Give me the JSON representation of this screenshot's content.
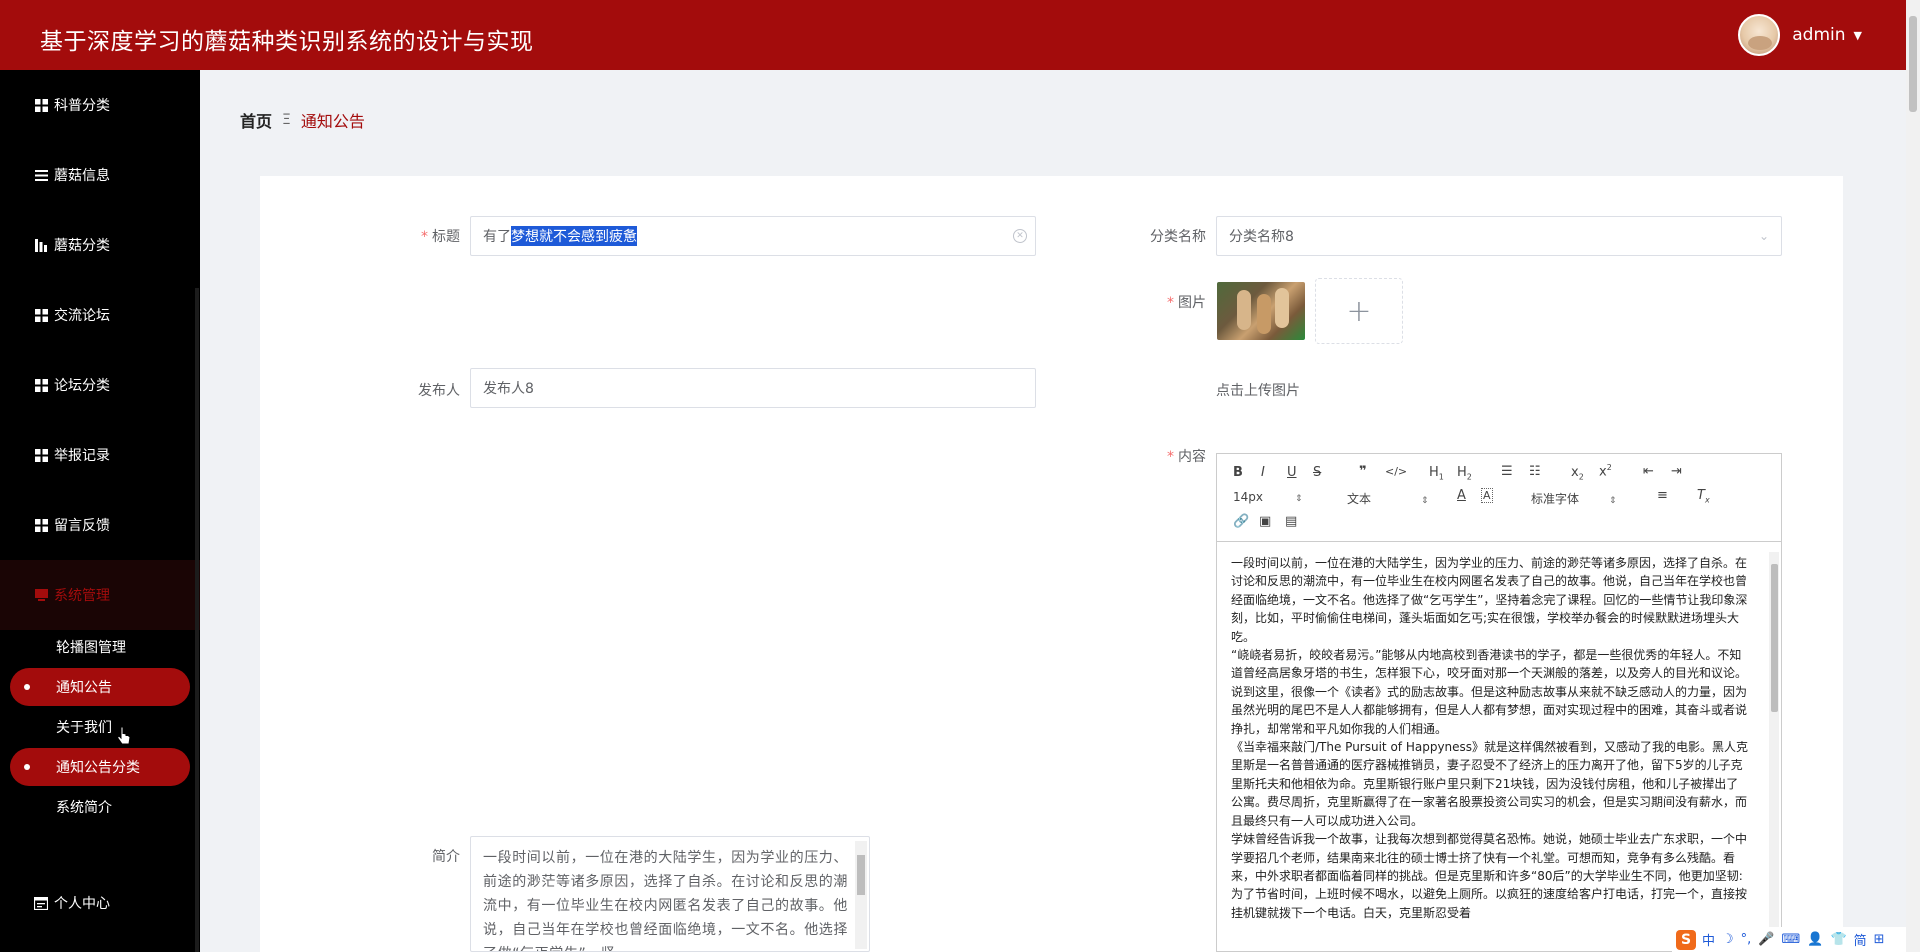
{
  "header": {
    "title": "基于深度学习的蘑菇种类识别系统的设计与实现",
    "username": "admin",
    "caret": "▼"
  },
  "sidebar": {
    "items": [
      {
        "label": "科普分类",
        "icon": "grid-icon"
      },
      {
        "label": "蘑菇信息",
        "icon": "list-icon"
      },
      {
        "label": "蘑菇分类",
        "icon": "chart-icon"
      },
      {
        "label": "交流论坛",
        "icon": "grid-icon"
      },
      {
        "label": "论坛分类",
        "icon": "grid-icon"
      },
      {
        "label": "举报记录",
        "icon": "grid-icon"
      },
      {
        "label": "留言反馈",
        "icon": "grid-icon"
      },
      {
        "label": "系统管理",
        "icon": "card-icon",
        "active": true
      }
    ],
    "sub_items": [
      {
        "label": "轮播图管理",
        "selected": false
      },
      {
        "label": "通知公告",
        "selected": true
      },
      {
        "label": "关于我们",
        "selected": false
      },
      {
        "label": "通知公告分类",
        "selected": true
      },
      {
        "label": "系统简介",
        "selected": false
      }
    ],
    "personal": {
      "label": "个人中心",
      "icon": "profile-icon"
    }
  },
  "breadcrumb": {
    "home": "首页",
    "separator": "Ξ",
    "current": "通知公告"
  },
  "form": {
    "title_label": "标题",
    "title_value_prefix": "有了",
    "title_value_selected": "梦想就不会感到疲惫",
    "category_label": "分类名称",
    "category_value": "分类名称8",
    "image_label": "图片",
    "upload_plus": "+",
    "upload_hint": "点击上传图片",
    "publisher_label": "发布人",
    "publisher_placeholder": "发布人8",
    "content_label": "内容",
    "summary_label": "简介",
    "summary_text": "一段时间以前，一位在港的大陆学生，因为学业的压力、前途的渺茫等诸多原因，选择了自杀。在讨论和反思的潮流中，有一位毕业生在校内网匿名发表了自己的故事。他说，自己当年在学校也曾经面临绝境，一文不名。他选择了做“乞丐学生”，坚"
  },
  "editor": {
    "font_size": "14px",
    "block_type": "文本",
    "font_family": "标准字体",
    "paragraphs": [
      "一段时间以前，一位在港的大陆学生，因为学业的压力、前途的渺茫等诸多原因，选择了自杀。在讨论和反思的潮流中，有一位毕业生在校内网匿名发表了自己的故事。他说，自己当年在学校也曾经面临绝境，一文不名。他选择了做“乞丐学生”，坚持着念完了课程。回忆的一些情节让我印象深刻，比如，平时偷偷住电梯间，蓬头垢面如乞丐;实在很饿，学校举办餐会的时候默默进场埋头大吃。",
      "“峣峣者易折，皎皎者易污。”能够从内地高校到香港读书的学子，都是一些很优秀的年轻人。不知道曾经高居象牙塔的书生，怎样狠下心，咬牙面对那一个天渊般的落差，以及旁人的目光和议论。",
      "说到这里，很像一个《读者》式的励志故事。但是这种励志故事从来就不缺乏感动人的力量，因为虽然光明的尾巴不是人人都能够拥有，但是人人都有梦想，面对实现过程中的困难，其奋斗或者说挣扎，却常常和平凡如你我的人们相通。",
      "《当幸福来敲门/The Pursuit of Happyness》就是这样偶然被看到，又感动了我的电影。黑人克里斯是一名普普通通的医疗器械推销员，妻子忍受不了经济上的压力离开了他，留下5岁的儿子克里斯托夫和他相依为命。克里斯银行账户里只剩下21块钱，因为没钱付房租，他和儿子被撵出了公寓。费尽周折，克里斯赢得了在一家著名股票投资公司实习的机会，但是实习期间没有薪水，而且最终只有一人可以成功进入公司。",
      "学妹曾经告诉我一个故事，让我每次想到都觉得莫名恐怖。她说，她硕士毕业去广东求职，一个中学要招几个老师，结果南来北往的硕士博士挤了快有一个礼堂。可想而知，竞争有多么残酷。看来，中外求职者都面临着同样的挑战。但是克里斯和许多“80后”的大学毕业生不同，他更加坚韧:为了节省时间，上班时候不喝水，以避免上厕所。以疯狂的速度给客户打电话，打完一个，直接按挂机键就拨下一个电话。白天，克里斯忍受着"
    ]
  },
  "ime": {
    "logo": "S",
    "labels": [
      "中",
      "☽",
      "°,",
      "🎤",
      "⌨",
      "👤",
      "👕",
      "简",
      "⊞"
    ]
  }
}
